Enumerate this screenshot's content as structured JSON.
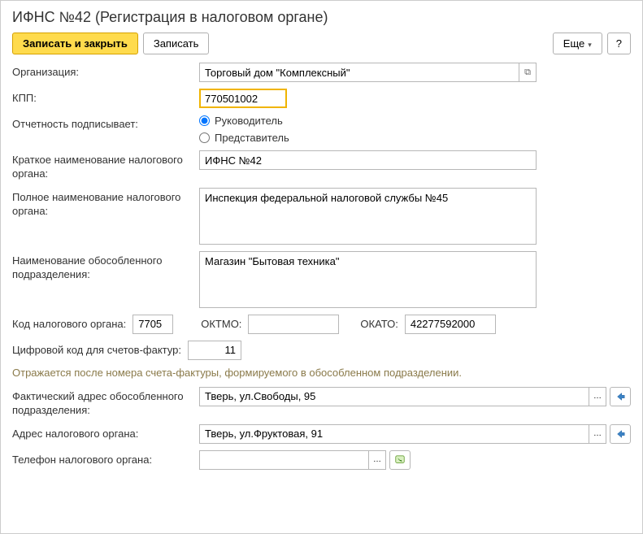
{
  "title": "ИФНС №42 (Регистрация в налоговом органе)",
  "toolbar": {
    "save_close": "Записать и закрыть",
    "save": "Записать",
    "more": "Еще",
    "help": "?"
  },
  "labels": {
    "organization": "Организация:",
    "kpp": "КПП:",
    "signer": "Отчетность подписывает:",
    "short_name": "Краткое наименование налогового органа:",
    "full_name": "Полное наименование налогового органа:",
    "unit_name": "Наименование обособленного подразделения:",
    "tax_code": "Код налогового органа:",
    "oktmo": "ОКТМО:",
    "okato": "ОКАТО:",
    "digital_code": "Цифровой код для счетов-фактур:",
    "hint": "Отражается после номера счета-фактуры, формируемого в обособленном подразделении.",
    "actual_address": "Фактический адрес обособленного подразделения:",
    "tax_address": "Адрес налогового органа:",
    "phone": "Телефон налогового органа:"
  },
  "values": {
    "organization": "Торговый дом \"Комплексный\"",
    "kpp": "770501002",
    "short_name": "ИФНС №42",
    "full_name": "Инспекция федеральной налоговой службы №45",
    "unit_name": "Магазин \"Бытовая техника\"",
    "tax_code": "7705",
    "oktmo": "",
    "okato": "42277592000",
    "digital_code": "11",
    "actual_address": "Тверь, ул.Свободы, 95",
    "tax_address": "Тверь, ул.Фруктовая, 91",
    "phone": ""
  },
  "radio": {
    "leader": "Руководитель",
    "representative": "Представитель"
  }
}
